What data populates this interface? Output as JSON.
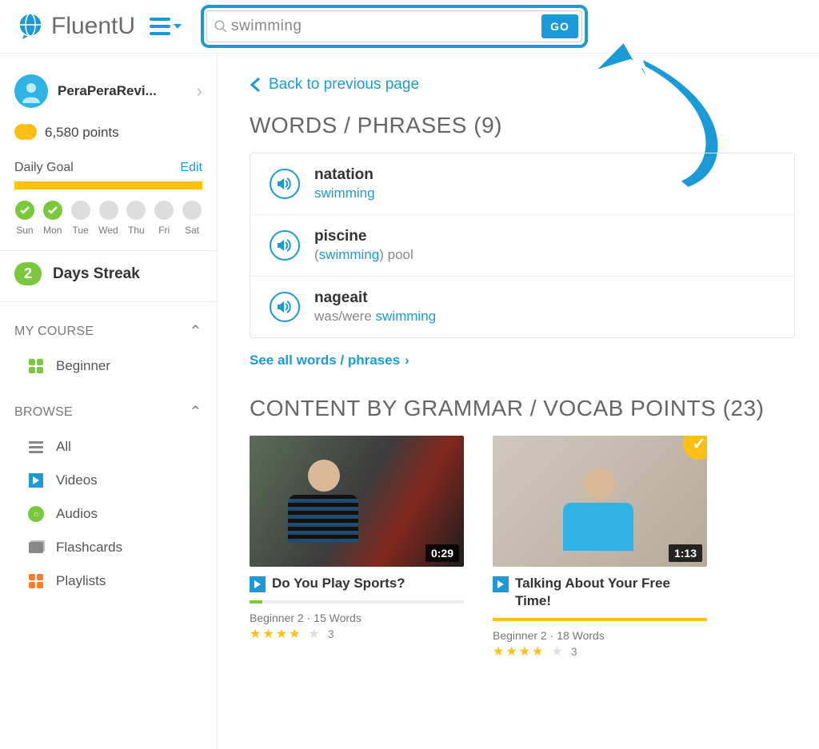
{
  "header": {
    "brand": "FluentU",
    "search_value": "swimming",
    "go_label": "GO"
  },
  "sidebar": {
    "username": "PeraPeraRevi...",
    "points": "6,580 points",
    "daily_goal_label": "Daily Goal",
    "edit_label": "Edit",
    "days": [
      {
        "abbr": "Sun",
        "done": true
      },
      {
        "abbr": "Mon",
        "done": true
      },
      {
        "abbr": "Tue",
        "done": false
      },
      {
        "abbr": "Wed",
        "done": false
      },
      {
        "abbr": "Thu",
        "done": false
      },
      {
        "abbr": "Fri",
        "done": false
      },
      {
        "abbr": "Sat",
        "done": false
      }
    ],
    "streak_count": "2",
    "streak_label": "Days Streak",
    "section_my_course": "MY COURSE",
    "my_course_item": "Beginner",
    "section_browse": "BROWSE",
    "browse_items": [
      "All",
      "Videos",
      "Audios",
      "Flashcards",
      "Playlists"
    ]
  },
  "main": {
    "back_label": "Back to previous page",
    "words_title": "WORDS / PHRASES (9)",
    "words": [
      {
        "word": "natation",
        "def_pre": "",
        "def_hl": "swimming",
        "def_post": ""
      },
      {
        "word": "piscine",
        "def_pre": "(",
        "def_hl": "swimming",
        "def_post": ") pool"
      },
      {
        "word": "nageait",
        "def_pre": "was/were ",
        "def_hl": "swimming",
        "def_post": ""
      }
    ],
    "see_all": "See all words / phrases",
    "content_title": "CONTENT BY GRAMMAR / VOCAB POINTS (23)",
    "cards": [
      {
        "duration": "0:29",
        "title": "Do You Play Sports?",
        "meta": "Beginner 2 · 15 Words",
        "rating_count": "3",
        "progress_pct": 6,
        "progress_color": "#7ac93c",
        "checked": false
      },
      {
        "duration": "1:13",
        "title": "Talking About Your Free Time!",
        "meta": "Beginner 2 · 18 Words",
        "rating_count": "3",
        "progress_pct": 100,
        "progress_color": "#ffbf16",
        "checked": true
      }
    ]
  }
}
